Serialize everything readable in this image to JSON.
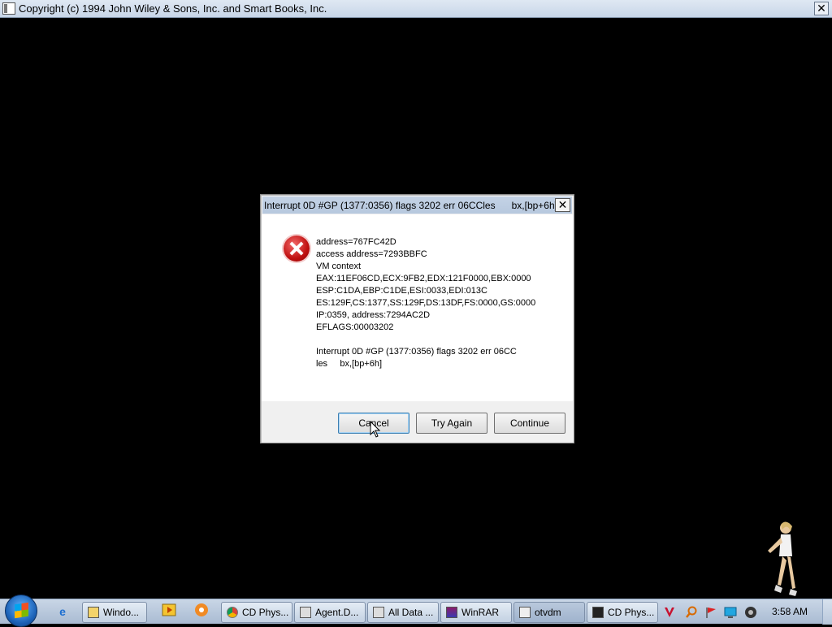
{
  "app": {
    "title": "Copyright (c) 1994 John Wiley & Sons, Inc. and Smart Books, Inc.",
    "close_glyph": "✕"
  },
  "dialog": {
    "title": "Interrupt 0D #GP (1377:0356) flags 3202 err 06CCles      bx,[bp+6h]",
    "close_glyph": "✕",
    "lines": [
      "address=767FC42D",
      "access address=7293BBFC",
      "VM context",
      "EAX:11EF06CD,ECX:9FB2,EDX:121F0000,EBX:0000",
      "ESP:C1DA,EBP:C1DE,ESI:0033,EDI:013C",
      "ES:129F,CS:1377,SS:129F,DS:13DF,FS:0000,GS:0000",
      "IP:0359, address:7294AC2D",
      "EFLAGS:00003202",
      "",
      "Interrupt 0D #GP (1377:0356) flags 3202 err 06CC",
      "les     bx,[bp+6h]"
    ],
    "buttons": {
      "cancel": "Cancel",
      "try_again": "Try Again",
      "continue": "Continue"
    }
  },
  "taskbar": {
    "items": [
      {
        "label": "Windo..."
      },
      {
        "label": "CD Phys..."
      },
      {
        "label": "Agent.D..."
      },
      {
        "label": "All Data ..."
      },
      {
        "label": "WinRAR"
      },
      {
        "label": "otvdm"
      },
      {
        "label": "CD Phys..."
      }
    ],
    "clock": "3:58 AM"
  },
  "colors": {
    "desktop": "#000000",
    "error_icon": "#c01010"
  }
}
